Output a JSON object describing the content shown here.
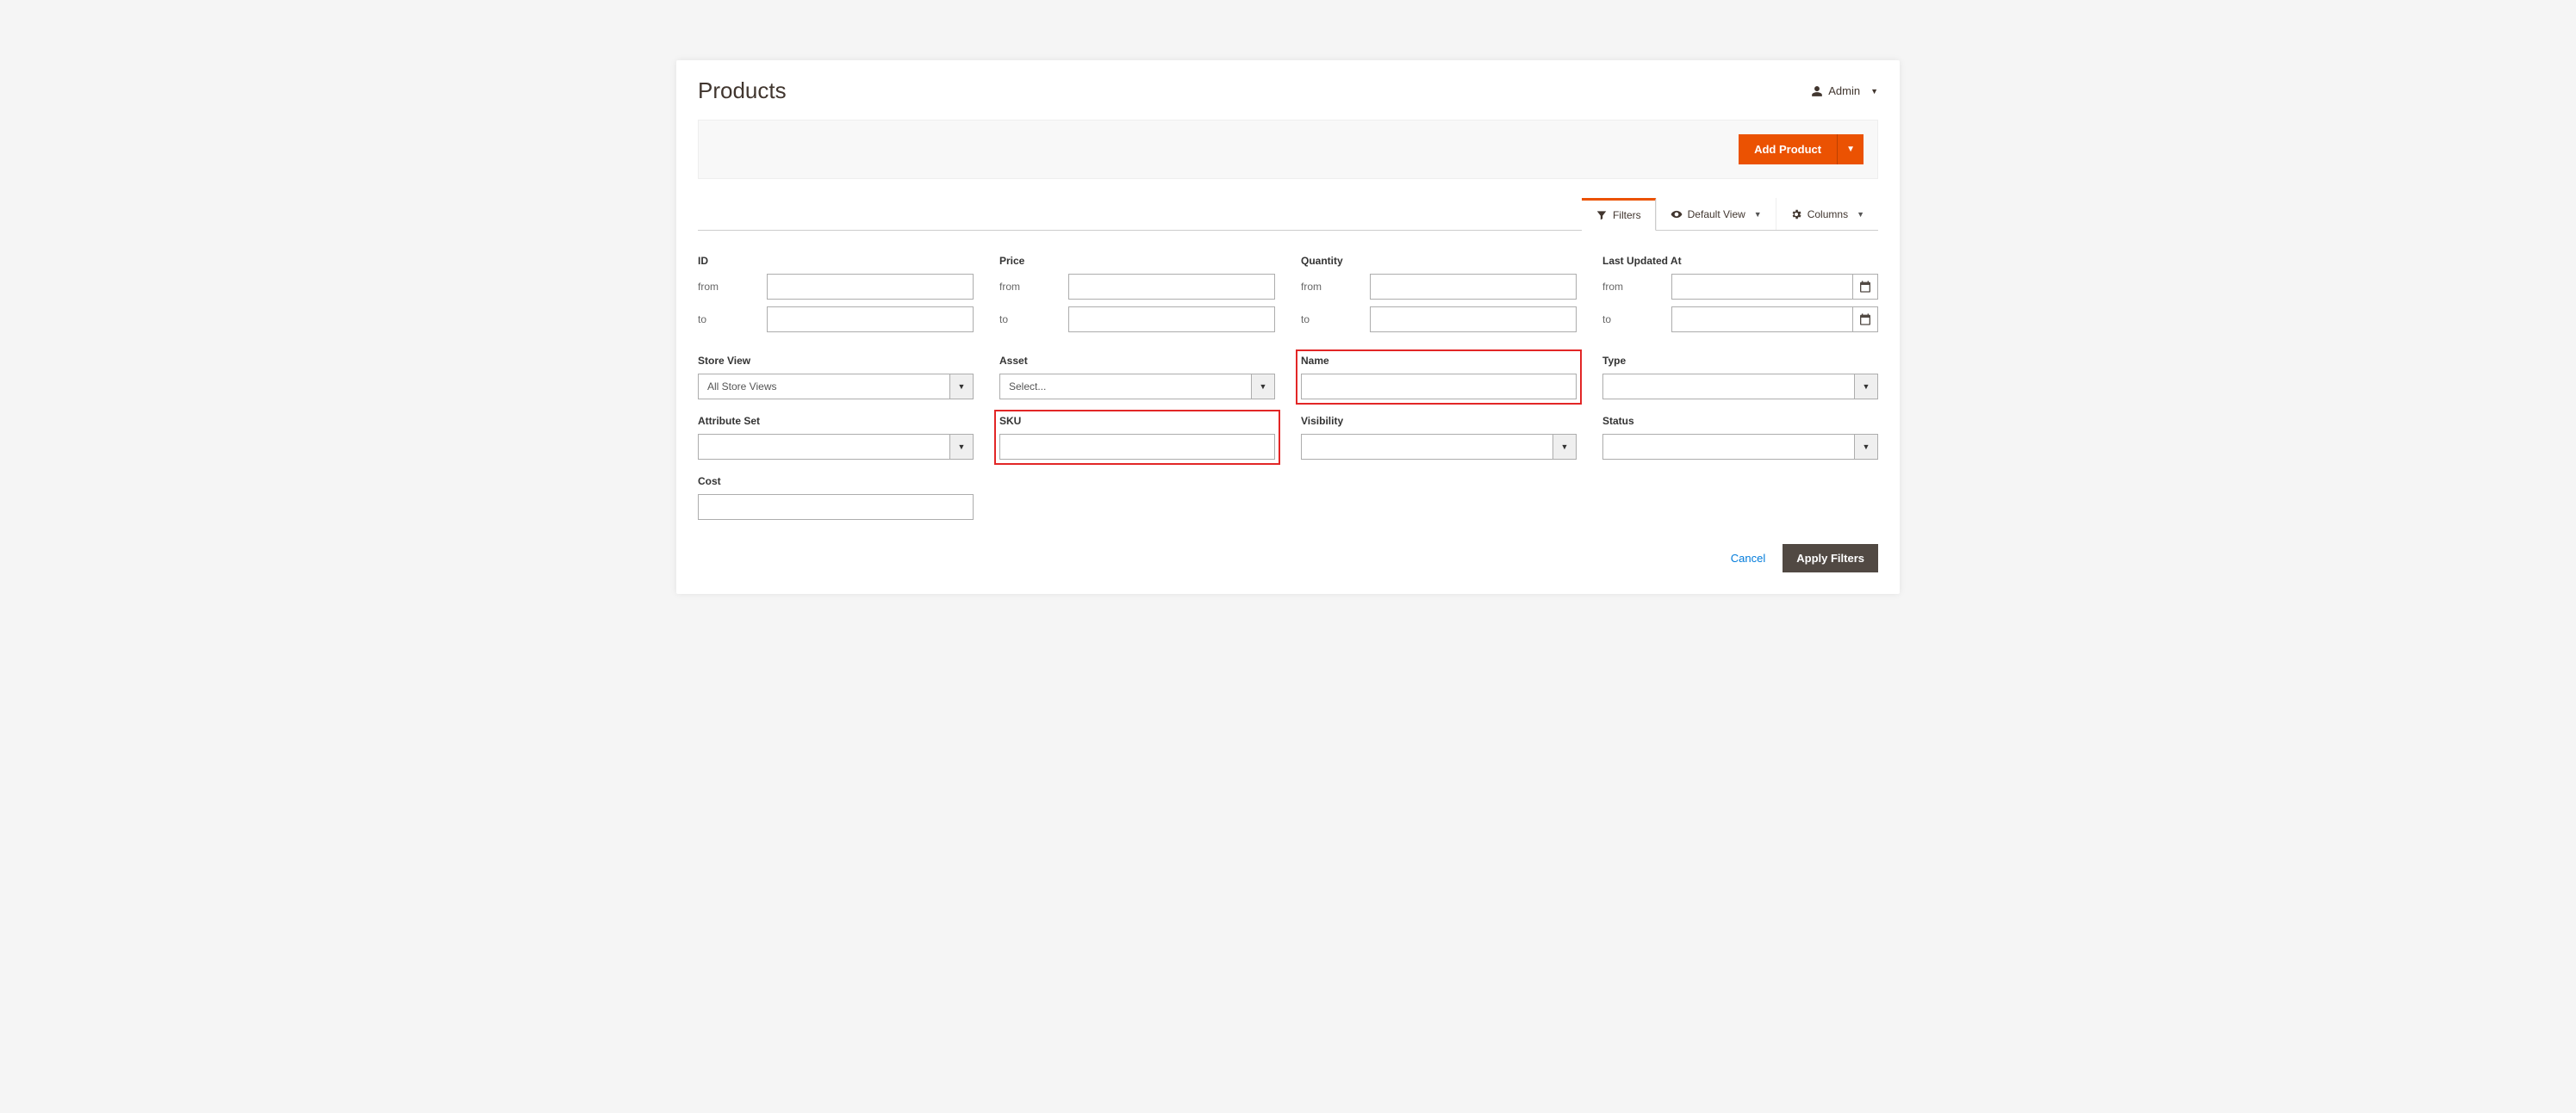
{
  "header": {
    "title": "Products",
    "admin_label": "Admin"
  },
  "toolbar": {
    "add_product_label": "Add Product"
  },
  "controls": {
    "filters_label": "Filters",
    "default_view_label": "Default View",
    "columns_label": "Columns"
  },
  "filters": {
    "id": {
      "title": "ID",
      "from_label": "from",
      "to_label": "to",
      "from_value": "",
      "to_value": ""
    },
    "price": {
      "title": "Price",
      "from_label": "from",
      "to_label": "to",
      "from_value": "",
      "to_value": ""
    },
    "quantity": {
      "title": "Quantity",
      "from_label": "from",
      "to_label": "to",
      "from_value": "",
      "to_value": ""
    },
    "last_updated": {
      "title": "Last Updated At",
      "from_label": "from",
      "to_label": "to",
      "from_value": "",
      "to_value": ""
    },
    "store_view": {
      "title": "Store View",
      "selected": "All Store Views"
    },
    "asset": {
      "title": "Asset",
      "selected": "Select..."
    },
    "name": {
      "title": "Name",
      "value": ""
    },
    "type": {
      "title": "Type",
      "selected": ""
    },
    "attribute_set": {
      "title": "Attribute Set",
      "selected": ""
    },
    "sku": {
      "title": "SKU",
      "value": ""
    },
    "visibility": {
      "title": "Visibility",
      "selected": ""
    },
    "status": {
      "title": "Status",
      "selected": ""
    },
    "cost": {
      "title": "Cost",
      "value": ""
    }
  },
  "footer": {
    "cancel_label": "Cancel",
    "apply_label": "Apply Filters"
  }
}
